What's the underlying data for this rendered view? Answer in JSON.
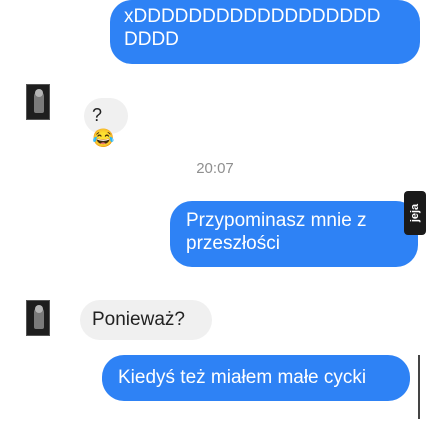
{
  "messages": {
    "m1": "xDDDDDDDDDDDDDDDDDD DDDD",
    "m2_text": "?",
    "m2_emoji": "😂",
    "timestamp": "20:07",
    "m3": "Przypominasz mnie z przeszłości",
    "m4": "Ponieważ?",
    "m5": "Kiedyś też miałem małe cycki"
  },
  "watermark": "jeja",
  "colors": {
    "outgoing": "#2e82f5",
    "incoming": "#f0f0f0"
  }
}
